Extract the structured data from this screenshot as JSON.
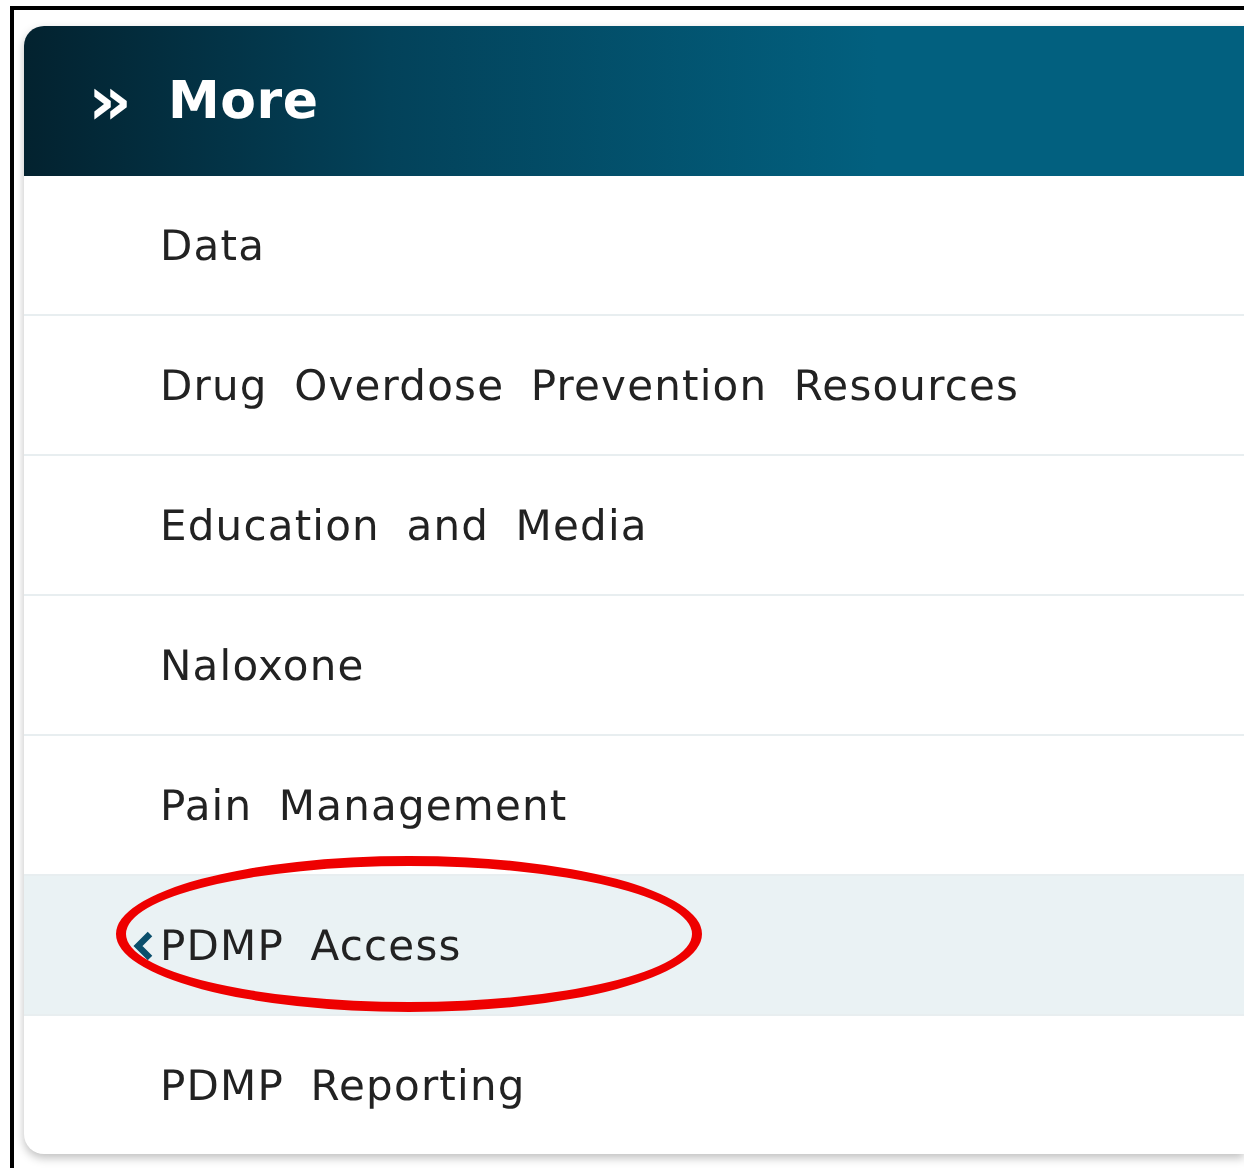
{
  "header": {
    "icon": "»",
    "title": "More"
  },
  "items": [
    {
      "label": "Data",
      "selected": false,
      "circled": false
    },
    {
      "label": "Drug Overdose Prevention Resources",
      "selected": false,
      "circled": false
    },
    {
      "label": "Education and Media",
      "selected": false,
      "circled": false
    },
    {
      "label": "Naloxone",
      "selected": false,
      "circled": false
    },
    {
      "label": "Pain Management",
      "selected": false,
      "circled": false
    },
    {
      "label": "PDMP Access",
      "selected": true,
      "circled": true
    },
    {
      "label": "PDMP Reporting",
      "selected": false,
      "circled": false
    }
  ]
}
